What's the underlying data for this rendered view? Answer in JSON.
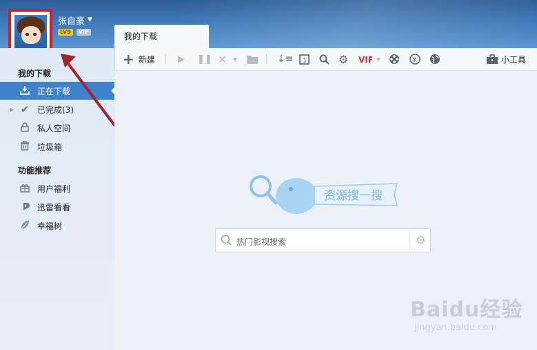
{
  "user": {
    "name": "张自豪",
    "level_badge": "LV9",
    "vip_badge": "VIP"
  },
  "tabs": [
    {
      "label": "我的下载"
    }
  ],
  "toolbar": {
    "new_label": "新建",
    "tools_label": "小工具"
  },
  "sidebar": {
    "section1_title": "我的下载",
    "items": [
      {
        "label": "正在下载",
        "icon": "download-icon",
        "active": true
      },
      {
        "label": "已完成(3)",
        "icon": "check-icon"
      },
      {
        "label": "私人空间",
        "icon": "lock-icon"
      },
      {
        "label": "垃圾箱",
        "icon": "trash-icon"
      }
    ],
    "section2_title": "功能推荐",
    "items2": [
      {
        "label": "用户福利",
        "icon": "gift-icon"
      },
      {
        "label": "迅雷看看",
        "icon": "kankan-icon"
      },
      {
        "label": "幸福树",
        "icon": "leaf-icon"
      }
    ]
  },
  "main": {
    "mascot_banner": "资源搜一搜",
    "search_placeholder": "热门影视搜索"
  },
  "watermark": {
    "main": "Baidu经验",
    "url": "jingyan.baidu.com"
  },
  "colors": {
    "header_blue": "#3d76b6",
    "active_item": "#3f82cc",
    "highlight_red": "#d0202a"
  }
}
